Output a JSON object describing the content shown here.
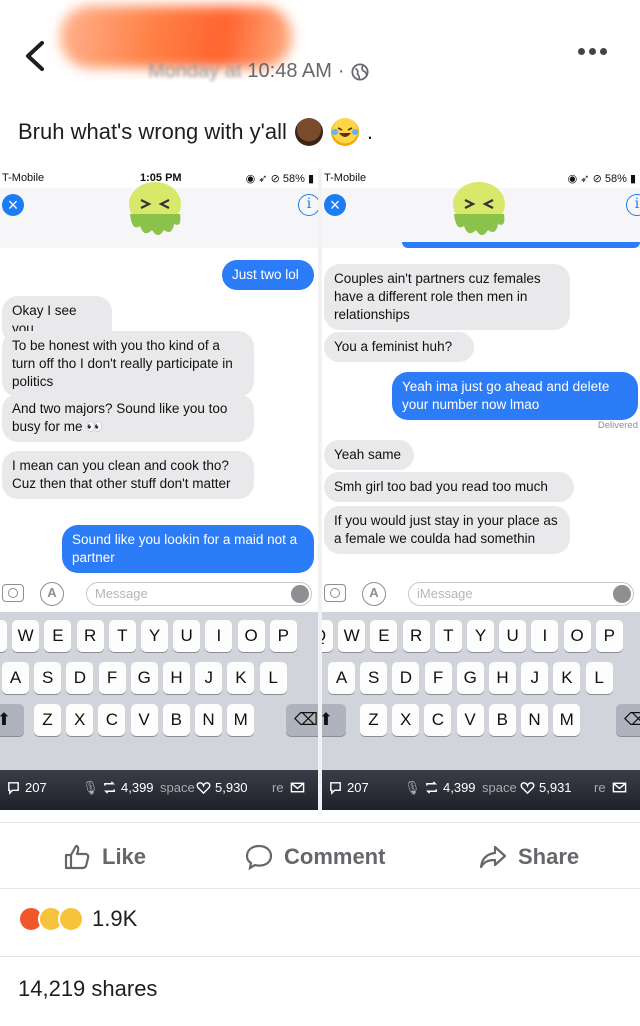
{
  "post": {
    "timestamp_hidden": "Monday at",
    "timestamp_visible": "10:48 AM",
    "timestamp_sep": "·",
    "text": "Bruh what's wrong with y'all",
    "text_tail": "."
  },
  "left_shot": {
    "carrier": "T-Mobile",
    "time": "1:05 PM",
    "battery": "58%",
    "messages": [
      {
        "dir": "out",
        "text": "Just two lol"
      },
      {
        "dir": "in",
        "text": "Okay I see you"
      },
      {
        "dir": "in",
        "text": "To be honest with you tho kind of a turn off tho I don't really participate in politics"
      },
      {
        "dir": "in",
        "text": "And two majors? Sound like you too busy for me 👀"
      },
      {
        "dir": "in",
        "text": "I mean can you clean and cook tho? Cuz then that other stuff don't matter"
      },
      {
        "dir": "out",
        "text": "Sound like you lookin for a maid not a partner"
      }
    ],
    "input_placeholder": "Message",
    "stats": {
      "comments": "207",
      "retweets": "4,399",
      "likes": "5,930"
    }
  },
  "right_shot": {
    "carrier": "T-Mobile",
    "battery": "58%",
    "messages": [
      {
        "dir": "in",
        "text": "Couples ain't partners cuz females have a different role then men in relationships"
      },
      {
        "dir": "in",
        "text": "You a feminist huh?"
      },
      {
        "dir": "out",
        "text": "Yeah ima just go ahead and delete your number now lmao"
      },
      {
        "dir": "in",
        "text": "Yeah same"
      },
      {
        "dir": "in",
        "text": "Smh girl too bad you read too much"
      },
      {
        "dir": "in",
        "text": "If you would just stay in your place as a female we coulda had somethin"
      }
    ],
    "delivered": "Delivered",
    "input_placeholder": "iMessage",
    "stats": {
      "comments": "207",
      "retweets": "4,399",
      "likes": "5,931"
    }
  },
  "keyboard": {
    "row1": [
      "Q",
      "W",
      "E",
      "R",
      "T",
      "Y",
      "U",
      "I",
      "O",
      "P"
    ],
    "row2": [
      "A",
      "S",
      "D",
      "F",
      "G",
      "H",
      "J",
      "K",
      "L"
    ],
    "row3": [
      "Z",
      "X",
      "C",
      "V",
      "B",
      "N",
      "M"
    ],
    "space_ghost": "space",
    "return_ghost": "re"
  },
  "actions": {
    "like": "Like",
    "comment": "Comment",
    "share": "Share"
  },
  "summary": {
    "reactions": "1.9K",
    "shares": "14,219 shares"
  },
  "colors": {
    "imessage_blue": "#2b7cf6",
    "bubble_gray": "#e9e9eb",
    "fb_gray": "#65676b"
  }
}
